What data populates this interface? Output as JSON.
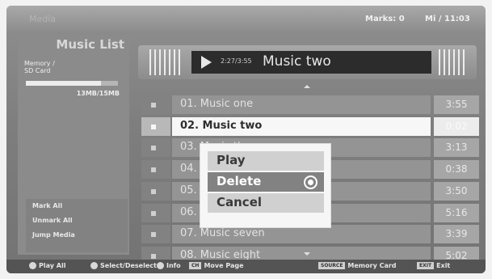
{
  "topbar": {
    "tv_label": "Media",
    "marks": "Marks: 0",
    "clock": "Mi / 11:03"
  },
  "sidebar": {
    "title": "Music List",
    "memory_label": "Memory /\nSD Card",
    "memory_used_fraction": 0.82,
    "memory_count": "13MB/15MB",
    "buttons": [
      "Mark All",
      "Unmark All",
      "Jump Media"
    ]
  },
  "now_playing": {
    "state_icon": "play-icon",
    "time": "2:27/3:55",
    "track": "Music two"
  },
  "tracks": [
    {
      "name": "01. Music one",
      "duration": "3:55",
      "selected": false
    },
    {
      "name": "02. Music two",
      "duration": "0:02",
      "selected": true
    },
    {
      "name": "03. Music three",
      "duration": "3:13",
      "selected": false
    },
    {
      "name": "04. Music four",
      "duration": "0:38",
      "selected": false
    },
    {
      "name": "05. Music five",
      "duration": "3:50",
      "selected": false
    },
    {
      "name": "06. Music six",
      "duration": "5:16",
      "selected": false
    },
    {
      "name": "07. Music seven",
      "duration": "3:39",
      "selected": false
    },
    {
      "name": "08. Music eight",
      "duration": "5:02",
      "selected": false
    }
  ],
  "popup": {
    "items": [
      {
        "label": "Play",
        "active": false
      },
      {
        "label": "Delete",
        "active": true
      },
      {
        "label": "Cancel",
        "active": false
      }
    ]
  },
  "bottombar": {
    "play_all": "Play All",
    "select_deselect": "Select/Deselect",
    "info": "Info",
    "move_page": "Move Page",
    "memory_card": "Memory Card",
    "exit": "Exit",
    "move_page_key": "CH",
    "memory_card_key": "SOURCE",
    "exit_key": "EXIT"
  },
  "colors": {
    "selected_row": "#f7f7f7",
    "active_menu_item": "#828282"
  }
}
